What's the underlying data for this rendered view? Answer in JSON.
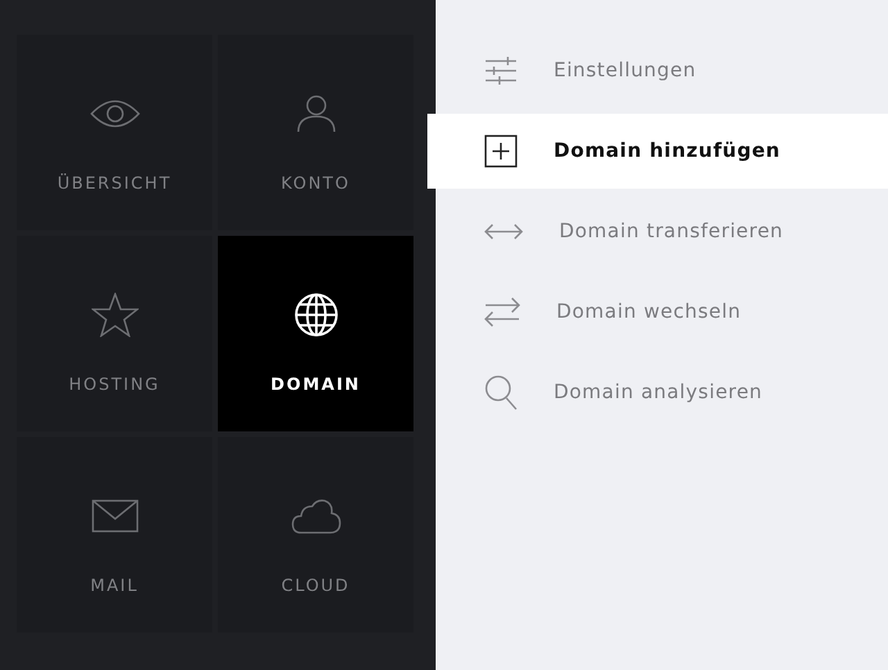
{
  "tiles": [
    {
      "label": "ÜBERSICHT",
      "kind": "eye",
      "selected": false
    },
    {
      "label": "KONTO",
      "kind": "user",
      "selected": false
    },
    {
      "label": "HOSTING",
      "kind": "star",
      "selected": false
    },
    {
      "label": "DOMAIN",
      "kind": "globe",
      "selected": true
    },
    {
      "label": "MAIL",
      "kind": "mail",
      "selected": false
    },
    {
      "label": "CLOUD",
      "kind": "cloud",
      "selected": false
    }
  ],
  "menu": [
    {
      "label": "Einstellungen",
      "kind": "sliders",
      "selected": false
    },
    {
      "label": "Domain hinzufügen",
      "kind": "plus",
      "selected": true
    },
    {
      "label": "Domain transferieren",
      "kind": "transfer",
      "selected": false
    },
    {
      "label": "Domain wechseln",
      "kind": "swap",
      "selected": false
    },
    {
      "label": "Domain analysieren",
      "kind": "search",
      "selected": false
    }
  ]
}
